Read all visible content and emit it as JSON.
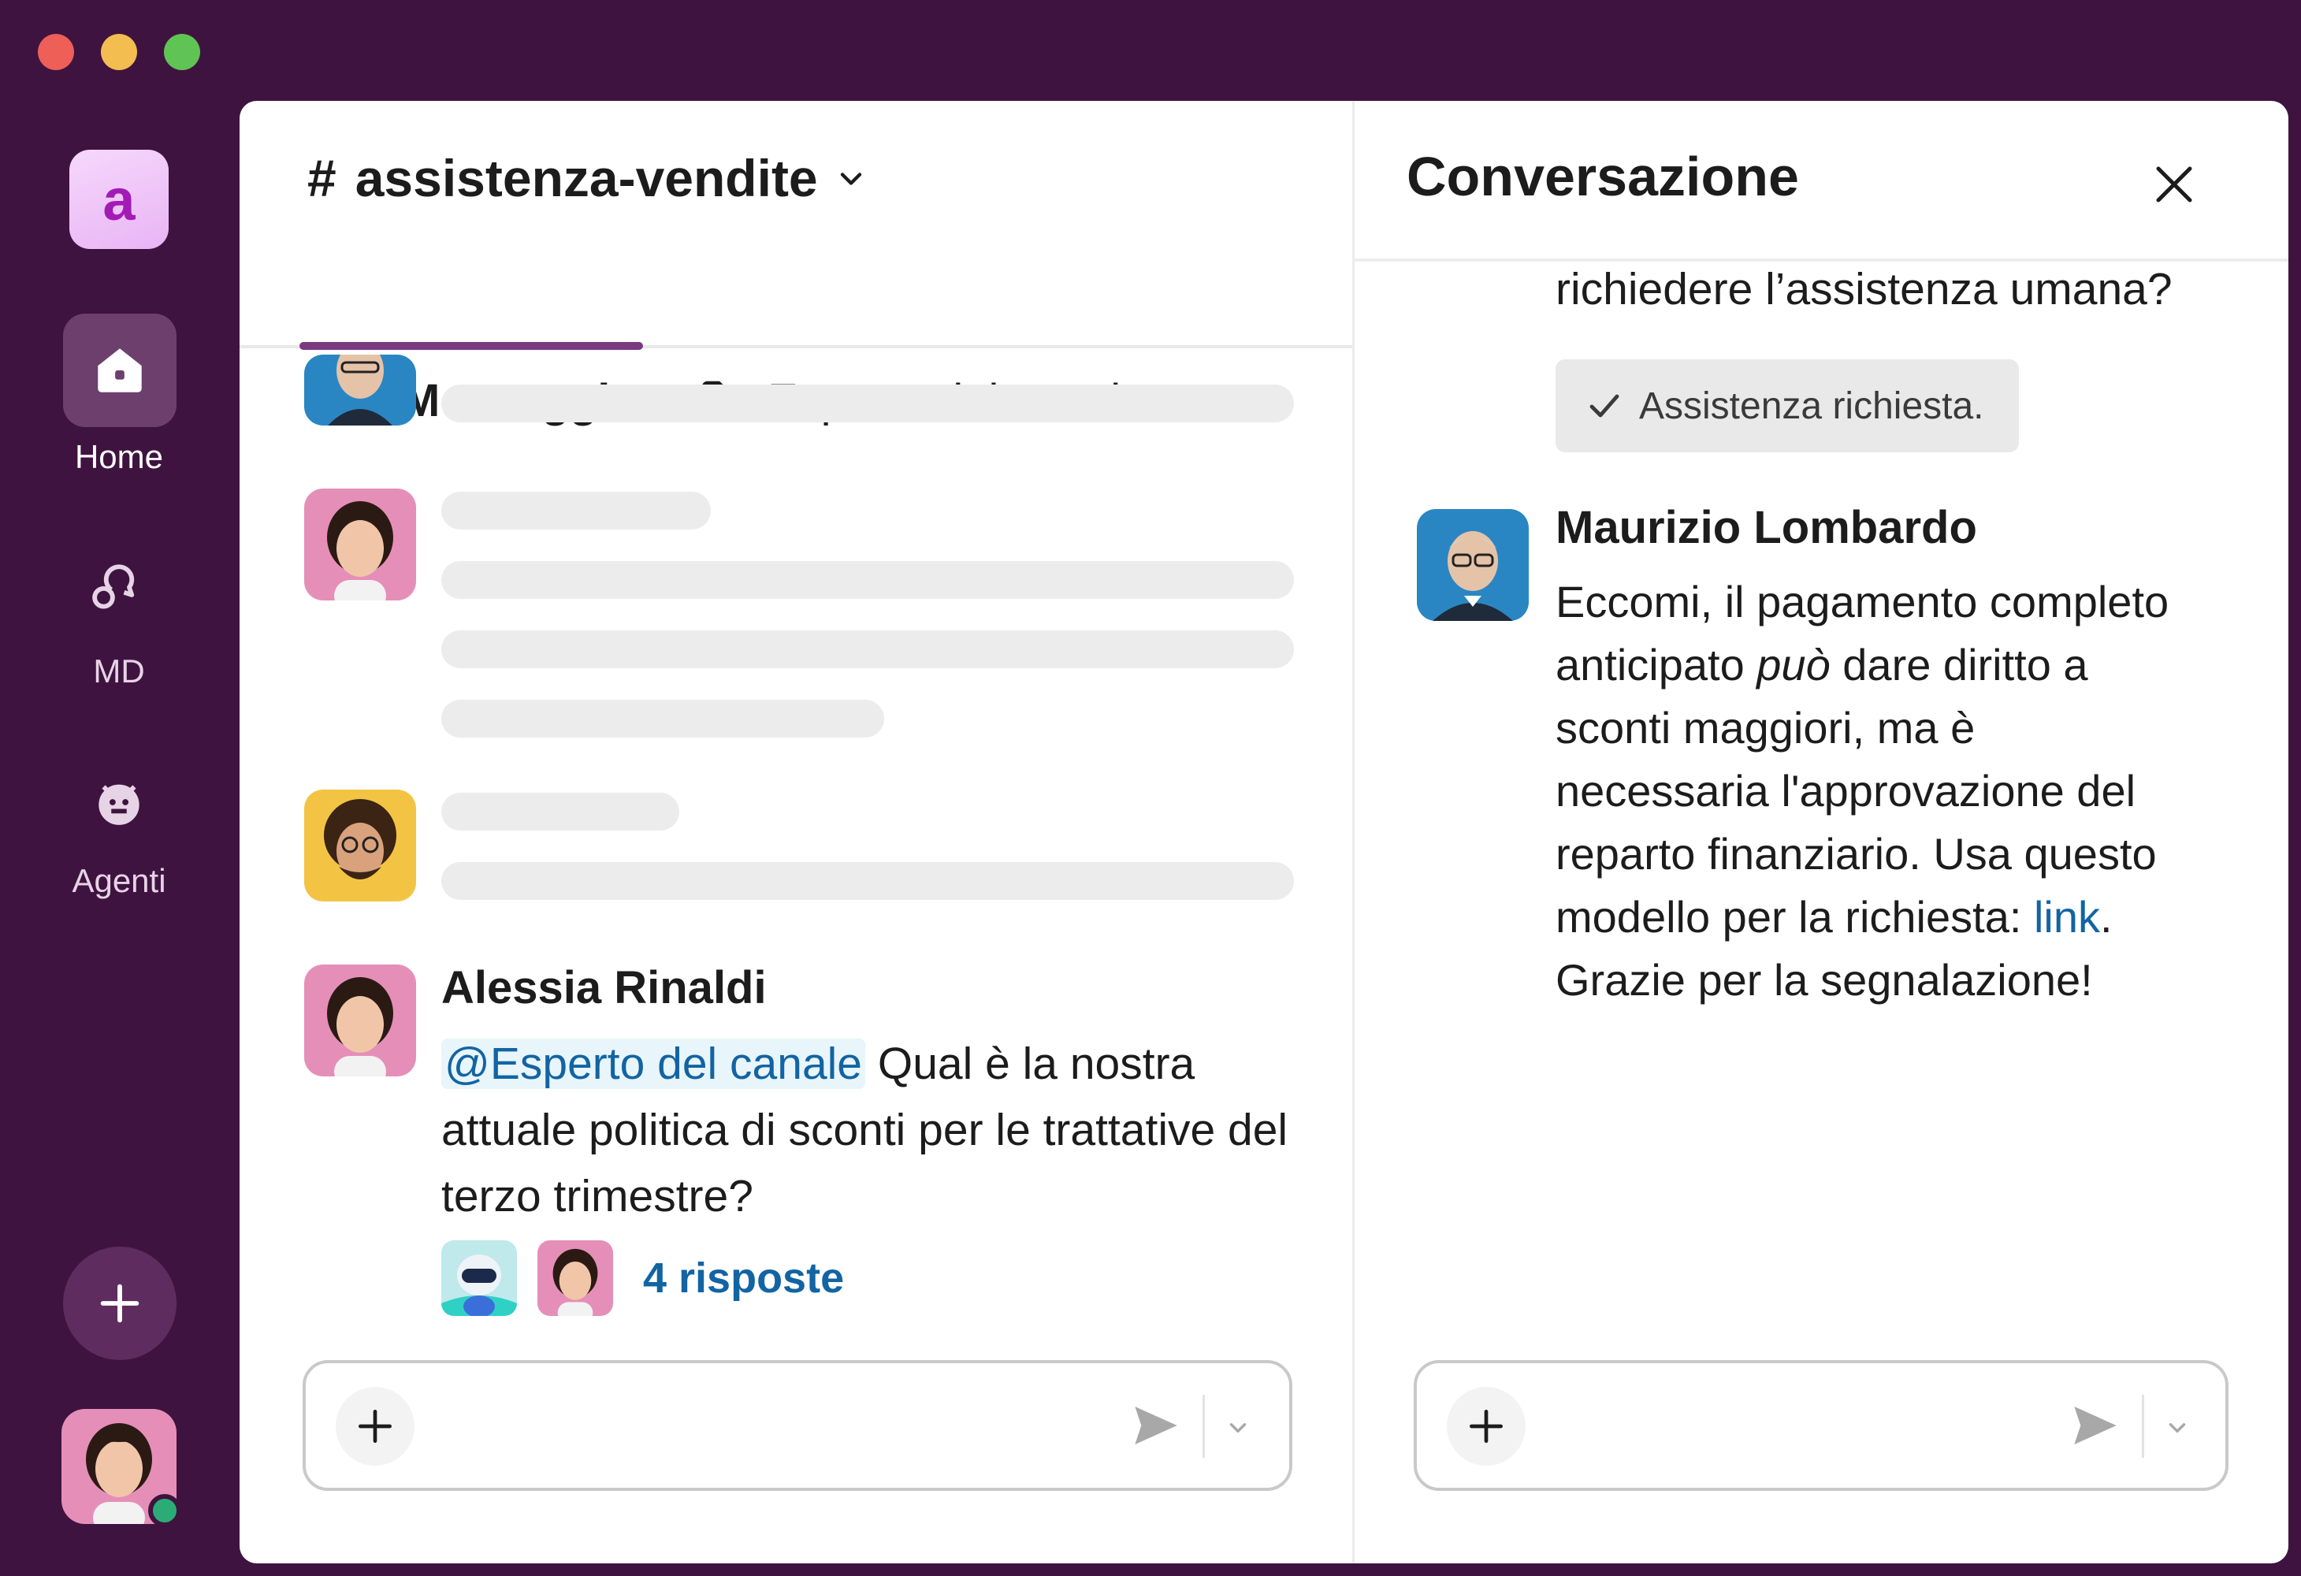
{
  "window_controls": [
    "close",
    "minimize",
    "zoom"
  ],
  "rail": {
    "workspace_initial": "a",
    "items": [
      {
        "label": "Home",
        "icon": "home-icon"
      },
      {
        "label": "MD",
        "icon": "dm-icon"
      },
      {
        "label": "Agenti",
        "icon": "agent-icon"
      }
    ],
    "add_icon": "plus-icon",
    "presence": "online"
  },
  "channel": {
    "name": "assistenza-vendite",
    "tabs": [
      {
        "label": "Messaggi",
        "icon": "messages-icon",
        "active": true
      },
      {
        "label": "Esperto del canale",
        "icon": "folder-icon",
        "active": false
      }
    ]
  },
  "message": {
    "author": "Alessia Rinaldi",
    "mention": "@Esperto del canale",
    "text": " Qual è la nostra attuale politica di sconti per le trattative del terzo trimestre?",
    "replies_label": "4 risposte"
  },
  "thread": {
    "title": "Conversazione",
    "top_text": "richiedere l’assistenza umana?",
    "assist_button": "Assistenza richiesta.",
    "reply_author": "Maurizio Lombardo",
    "reply_part1": "Eccomi, il pagamento completo anticipato ",
    "reply_italic": "può",
    "reply_part2": " dare diritto a sconti maggiori, ma è necessaria l'approvazione del reparto finanziario. Usa questo modello per la richiesta: ",
    "reply_link": "link",
    "reply_part3": ". Grazie per la segnalazione!"
  },
  "colors": {
    "aubergine": "#3f1340",
    "accent": "#7b3a80",
    "link": "#1264a3",
    "presence": "#2bac76"
  }
}
